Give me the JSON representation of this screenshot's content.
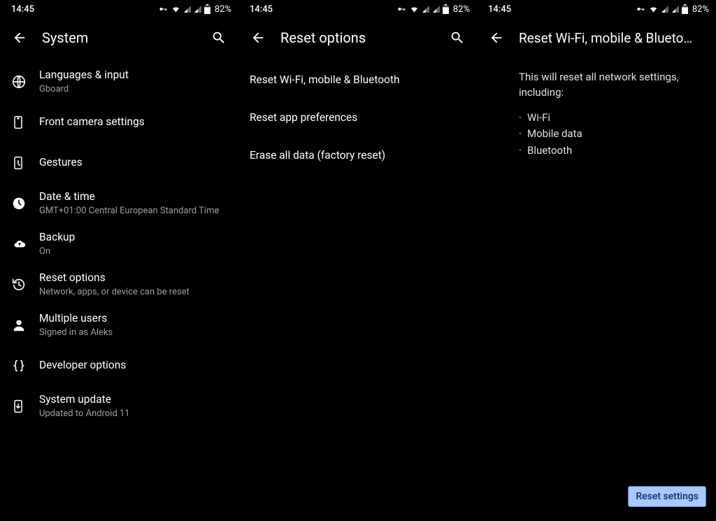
{
  "status": {
    "clock": "14:45",
    "battery_pct": "82%"
  },
  "screen1": {
    "title": "System",
    "items": [
      {
        "title": "Languages & input",
        "sub": "Gboard"
      },
      {
        "title": "Front camera settings",
        "sub": ""
      },
      {
        "title": "Gestures",
        "sub": ""
      },
      {
        "title": "Date & time",
        "sub": "GMT+01:00 Central European Standard Time"
      },
      {
        "title": "Backup",
        "sub": "On"
      },
      {
        "title": "Reset options",
        "sub": "Network, apps, or device can be reset"
      },
      {
        "title": "Multiple users",
        "sub": "Signed in as Aleks"
      },
      {
        "title": "Developer options",
        "sub": ""
      },
      {
        "title": "System update",
        "sub": "Updated to Android 11"
      }
    ]
  },
  "screen2": {
    "title": "Reset options",
    "items": [
      {
        "title": "Reset Wi-Fi, mobile & Bluetooth"
      },
      {
        "title": "Reset app preferences"
      },
      {
        "title": "Erase all data (factory reset)"
      }
    ]
  },
  "screen3": {
    "title": "Reset Wi-Fi, mobile & Blueto…",
    "intro": "This will reset all network settings, including:",
    "bullets": [
      "Wi-Fi",
      "Mobile data",
      "Bluetooth"
    ],
    "button": "Reset settings"
  }
}
